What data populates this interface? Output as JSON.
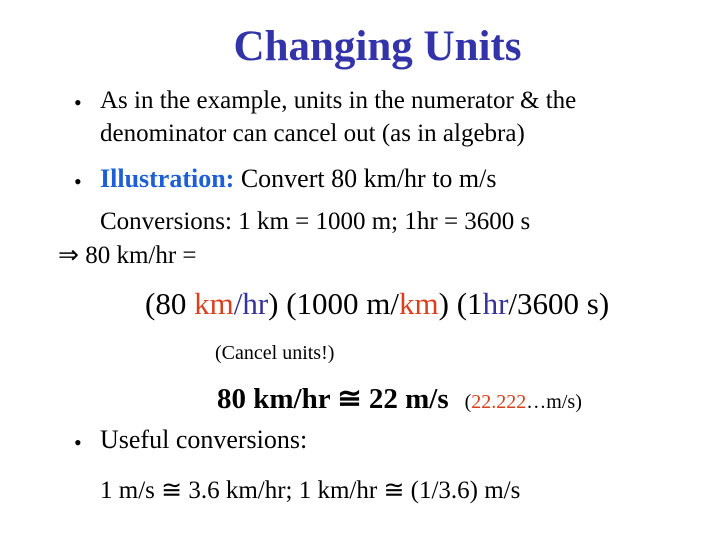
{
  "title": "Changing Units",
  "bullets": {
    "b1_line1": "As in the example, units in the numerator & the",
    "b1_line2": "denominator can cancel out (as in algebra)",
    "b2_label": "Illustration:",
    "b2_text": " Convert 80 km/hr to m/s",
    "conversions": "Conversions: 1 km = 1000 m; 1hr = 3600 s",
    "implies_symbol": "⇒",
    "implies_text": " 80 km/hr =",
    "expr": {
      "p1_open": "(80 ",
      "p1_num": "km",
      "p1_slash": "/",
      "p1_den": "hr",
      "p1_close": ") (1000 m/",
      "p2_den": "km",
      "p2_close": ") (1",
      "p3_num": "hr",
      "p3_rest": "/3600 s)"
    },
    "cancel_note": "(Cancel units!)",
    "result_bold": "80 km/hr ≅ 22 m/s",
    "result_paren_open": "(",
    "result_exact": "22.222",
    "result_paren_rest": "…m/s)",
    "b3_label": "Useful conversions:",
    "useful": "1 m/s ≅ 3.6 km/hr; 1 km/hr ≅ (1/3.6) m/s"
  },
  "bullet_symbol": "•",
  "colors": {
    "title": "#3333aa",
    "highlight_blue": "#1f5fd6",
    "unit_red": "#d9411e",
    "unit_navy": "#333399"
  }
}
